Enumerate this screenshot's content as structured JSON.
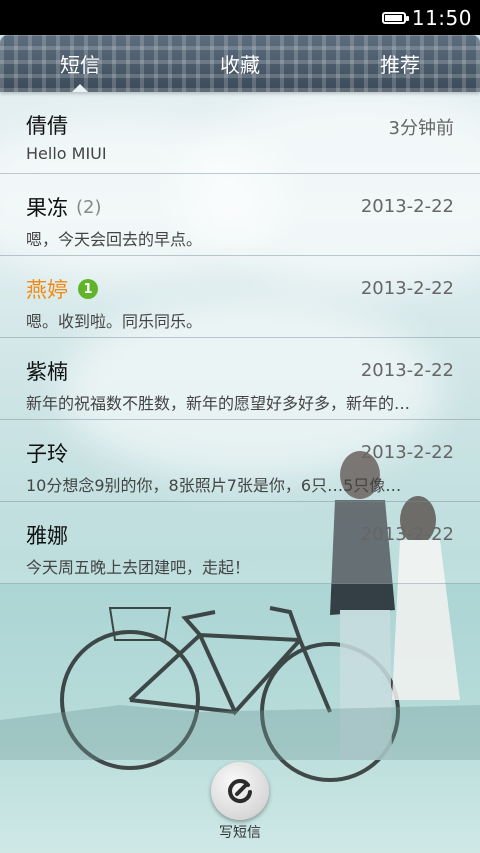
{
  "status_bar": {
    "time": "11:50",
    "battery_level": 0.85
  },
  "tabs": [
    {
      "label": "短信",
      "active": true
    },
    {
      "label": "收藏",
      "active": false
    },
    {
      "label": "推荐",
      "active": false
    }
  ],
  "conversations": [
    {
      "name": "倩倩",
      "count": "",
      "unread_badge": "",
      "date": "3分钟前",
      "preview": "Hello MIUI"
    },
    {
      "name": "果冻",
      "count": "(2)",
      "unread_badge": "",
      "date": "2013-2-22",
      "preview": "嗯，今天会回去的早点。"
    },
    {
      "name": "燕婷",
      "count": "",
      "unread_badge": "1",
      "date": "2013-2-22",
      "preview": "嗯。收到啦。同乐同乐。"
    },
    {
      "name": "紫楠",
      "count": "",
      "unread_badge": "",
      "date": "2013-2-22",
      "preview": "新年的祝福数不胜数，新年的愿望好多好多，新年的…"
    },
    {
      "name": "子玲",
      "count": "",
      "unread_badge": "",
      "date": "2013-2-22",
      "preview": "10分想念9别的你，8张照片7张是你，6只…5只像…"
    },
    {
      "name": "雅娜",
      "count": "",
      "unread_badge": "",
      "date": "2013-2-22",
      "preview": "今天周五晚上去团建吧，走起！"
    }
  ],
  "compose": {
    "label": "写短信",
    "icon": "compose-icon"
  },
  "colors": {
    "unread_name": "#f18a12",
    "badge": "#62b32c",
    "tabbar": "#4f6070"
  }
}
